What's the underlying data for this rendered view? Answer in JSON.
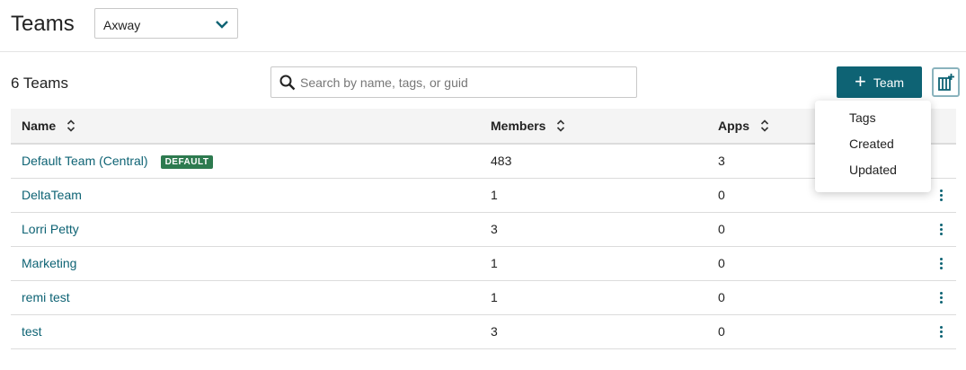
{
  "header": {
    "title": "Teams",
    "org_select": {
      "value": "Axway"
    }
  },
  "toolbar": {
    "count_label": "6 Teams",
    "search_placeholder": "Search by name, tags, or guid",
    "search_value": "",
    "add_button_label": "Team"
  },
  "table": {
    "columns": [
      "Name",
      "Members",
      "Apps"
    ],
    "rows": [
      {
        "name": "Default Team (Central)",
        "badge": "DEFAULT",
        "members": "483",
        "apps": "3"
      },
      {
        "name": "DeltaTeam",
        "members": "1",
        "apps": "0"
      },
      {
        "name": "Lorri Petty",
        "members": "3",
        "apps": "0"
      },
      {
        "name": "Marketing",
        "members": "1",
        "apps": "0"
      },
      {
        "name": "remi test",
        "members": "1",
        "apps": "0"
      },
      {
        "name": "test",
        "members": "3",
        "apps": "0"
      }
    ]
  },
  "columns_menu": {
    "items": [
      "Tags",
      "Created",
      "Updated"
    ]
  },
  "icons": {
    "org_dropdown": "chevron-down-icon",
    "search": "search-icon",
    "add": "plus-icon",
    "columns": "add-column-icon",
    "sort": "sort-icon",
    "row_actions": "kebab-menu-icon"
  },
  "colors": {
    "accent": "#0e6374",
    "badge_green": "#2d7a4f",
    "header_bg": "#f4f4f4"
  }
}
